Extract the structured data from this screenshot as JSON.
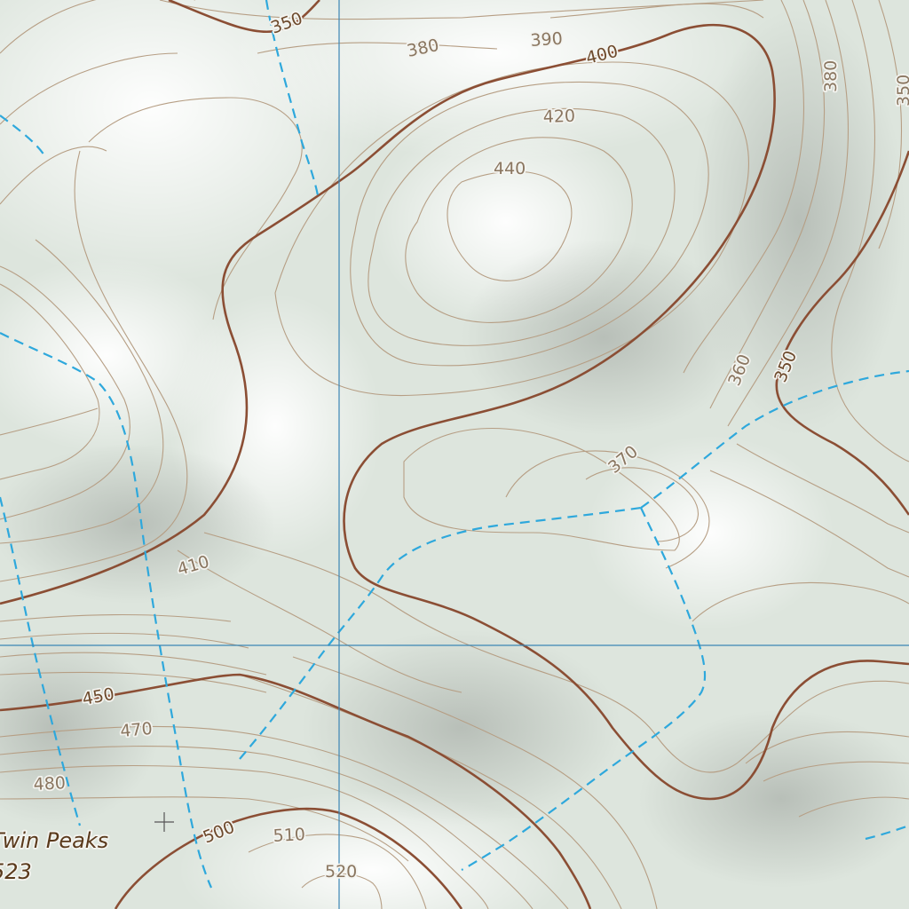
{
  "map": {
    "colors": {
      "background": "#dfe6df",
      "minor_contour": "#b69e84",
      "index_contour": "#8b4e34",
      "stream": "#2ea8dc",
      "grid_line": "#3b86b5",
      "summit_marker": "#555555"
    },
    "features": {
      "grid": "graticule lines",
      "streams": "intermittent (dashed)",
      "relief": "hillshade"
    },
    "contour_labels": [
      "350",
      "380",
      "390",
      "400",
      "420",
      "440",
      "380",
      "350",
      "360",
      "350",
      "370",
      "410",
      "450",
      "470",
      "480",
      "500",
      "510",
      "520"
    ],
    "peak": {
      "name": "Twin Peaks",
      "elevation": "523",
      "symbol": "summit-cross"
    }
  }
}
